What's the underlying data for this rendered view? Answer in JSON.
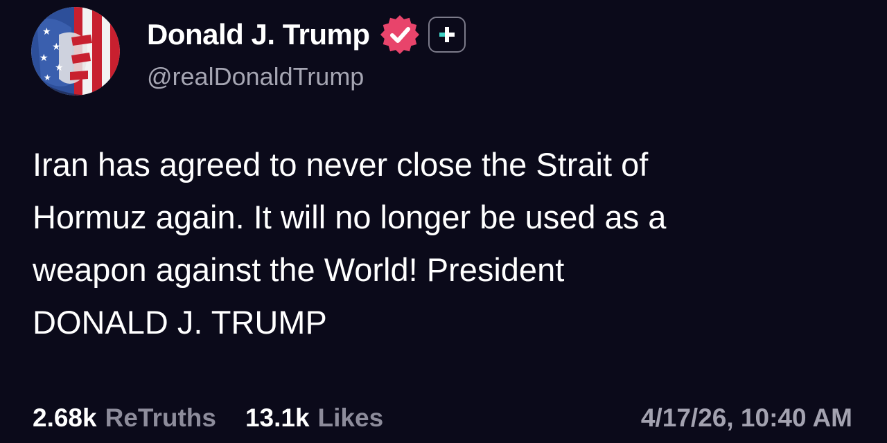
{
  "author": {
    "display_name": "Donald J. Trump",
    "handle": "@realDonaldTrump",
    "avatar_icon": "flag-portrait-avatar",
    "verified_icon": "verified-badge-icon",
    "verified_color": "#e8446b",
    "plus_icon": "plus-icon",
    "plus_accent": "#3fd1c4"
  },
  "post": {
    "lines": [
      "Iran has agreed to never close the Strait of",
      "Hormuz again. It will no longer be used as a",
      "weapon against the World! President",
      "DONALD J. TRUMP"
    ]
  },
  "stats": {
    "retruths_count": "2.68k",
    "retruths_label": "ReTruths",
    "likes_count": "13.1k",
    "likes_label": "Likes",
    "timestamp": "4/17/26, 10:40 AM"
  },
  "colors": {
    "background": "#0b0a1a",
    "text": "#ffffff",
    "muted": "#8d8c9b"
  }
}
